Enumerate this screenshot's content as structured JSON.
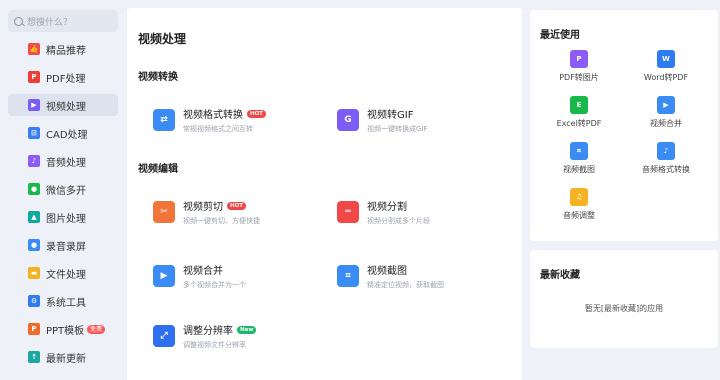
{
  "search": {
    "placeholder": "想搜什么？"
  },
  "sidebar": {
    "items": [
      {
        "label": "精品推荐",
        "icon": "thumbs-up-icon",
        "color": "#f24b4b"
      },
      {
        "label": "PDF处理",
        "icon": "pdf-icon",
        "color": "#ef3e36"
      },
      {
        "label": "视频处理",
        "icon": "video-play-icon",
        "color": "#7b5cf5"
      },
      {
        "label": "CAD处理",
        "icon": "cad-icon",
        "color": "#3a7ef2"
      },
      {
        "label": "音频处理",
        "icon": "music-note-icon",
        "color": "#8d5cf6"
      },
      {
        "label": "微信多开",
        "icon": "wechat-icon",
        "color": "#18b84a"
      },
      {
        "label": "图片处理",
        "icon": "image-icon",
        "color": "#13a89e"
      },
      {
        "label": "录音录屏",
        "icon": "microphone-icon",
        "color": "#3b8bf5"
      },
      {
        "label": "文件处理",
        "icon": "folder-icon",
        "color": "#f5b323"
      },
      {
        "label": "系统工具",
        "icon": "gear-icon",
        "color": "#2f7bf0"
      },
      {
        "label": "PPT模板",
        "icon": "ppt-icon",
        "color": "#f06a2c",
        "badge": "免费"
      },
      {
        "label": "最新更新",
        "icon": "upload-icon",
        "color": "#1ca7a0"
      }
    ]
  },
  "main": {
    "title": "视频处理",
    "section_convert": "视频转换",
    "section_edit": "视频编辑",
    "tools": [
      {
        "name": "视频格式转换",
        "desc": "常规视频格式之间互转",
        "badge": "HOT",
        "icon": "convert-arrows-icon",
        "color": "#3b8bf5"
      },
      {
        "name": "视频转GIF",
        "desc": "视频一键转换成GIF",
        "icon": "gif-icon",
        "color": "#7b5cf5"
      },
      {
        "name": "视频剪切",
        "desc": "视频一键剪切、方便快捷",
        "badge": "HOT",
        "icon": "scissors-icon",
        "color": "#f2743a"
      },
      {
        "name": "视频分割",
        "desc": "视频分割成多个片段",
        "icon": "split-icon",
        "color": "#f04747"
      },
      {
        "name": "视频合并",
        "desc": "多个视频合并为一个",
        "icon": "merge-play-icon",
        "color": "#3b8bf5"
      },
      {
        "name": "视频截图",
        "desc": "精准定位视频，获取截图",
        "icon": "crop-icon",
        "color": "#3b8bf5"
      },
      {
        "name": "调整分辨率",
        "desc": "调整视频文件分辨率",
        "badge": "New",
        "icon": "resolution-icon",
        "color": "#2f6ff0"
      }
    ]
  },
  "recent": {
    "title": "最近使用",
    "items": [
      {
        "label": "PDF转图片",
        "icon": "pdf-to-image-icon",
        "color": "#8d5cf6"
      },
      {
        "label": "Word转PDF",
        "icon": "word-to-pdf-icon",
        "color": "#2f7bf0"
      },
      {
        "label": "Excel转PDF",
        "icon": "excel-to-pdf-icon",
        "color": "#18b84a"
      },
      {
        "label": "视频合并",
        "icon": "merge-play-icon",
        "color": "#3b8bf5"
      },
      {
        "label": "视频截图",
        "icon": "crop-icon",
        "color": "#3b8bf5"
      },
      {
        "label": "音频格式转换",
        "icon": "music-note-icon",
        "color": "#3b8bf5"
      },
      {
        "label": "音频调整",
        "icon": "volume-icon",
        "color": "#f5b323"
      }
    ]
  },
  "favorites": {
    "title": "最新收藏",
    "empty": "暂无[最新收藏]的应用"
  }
}
